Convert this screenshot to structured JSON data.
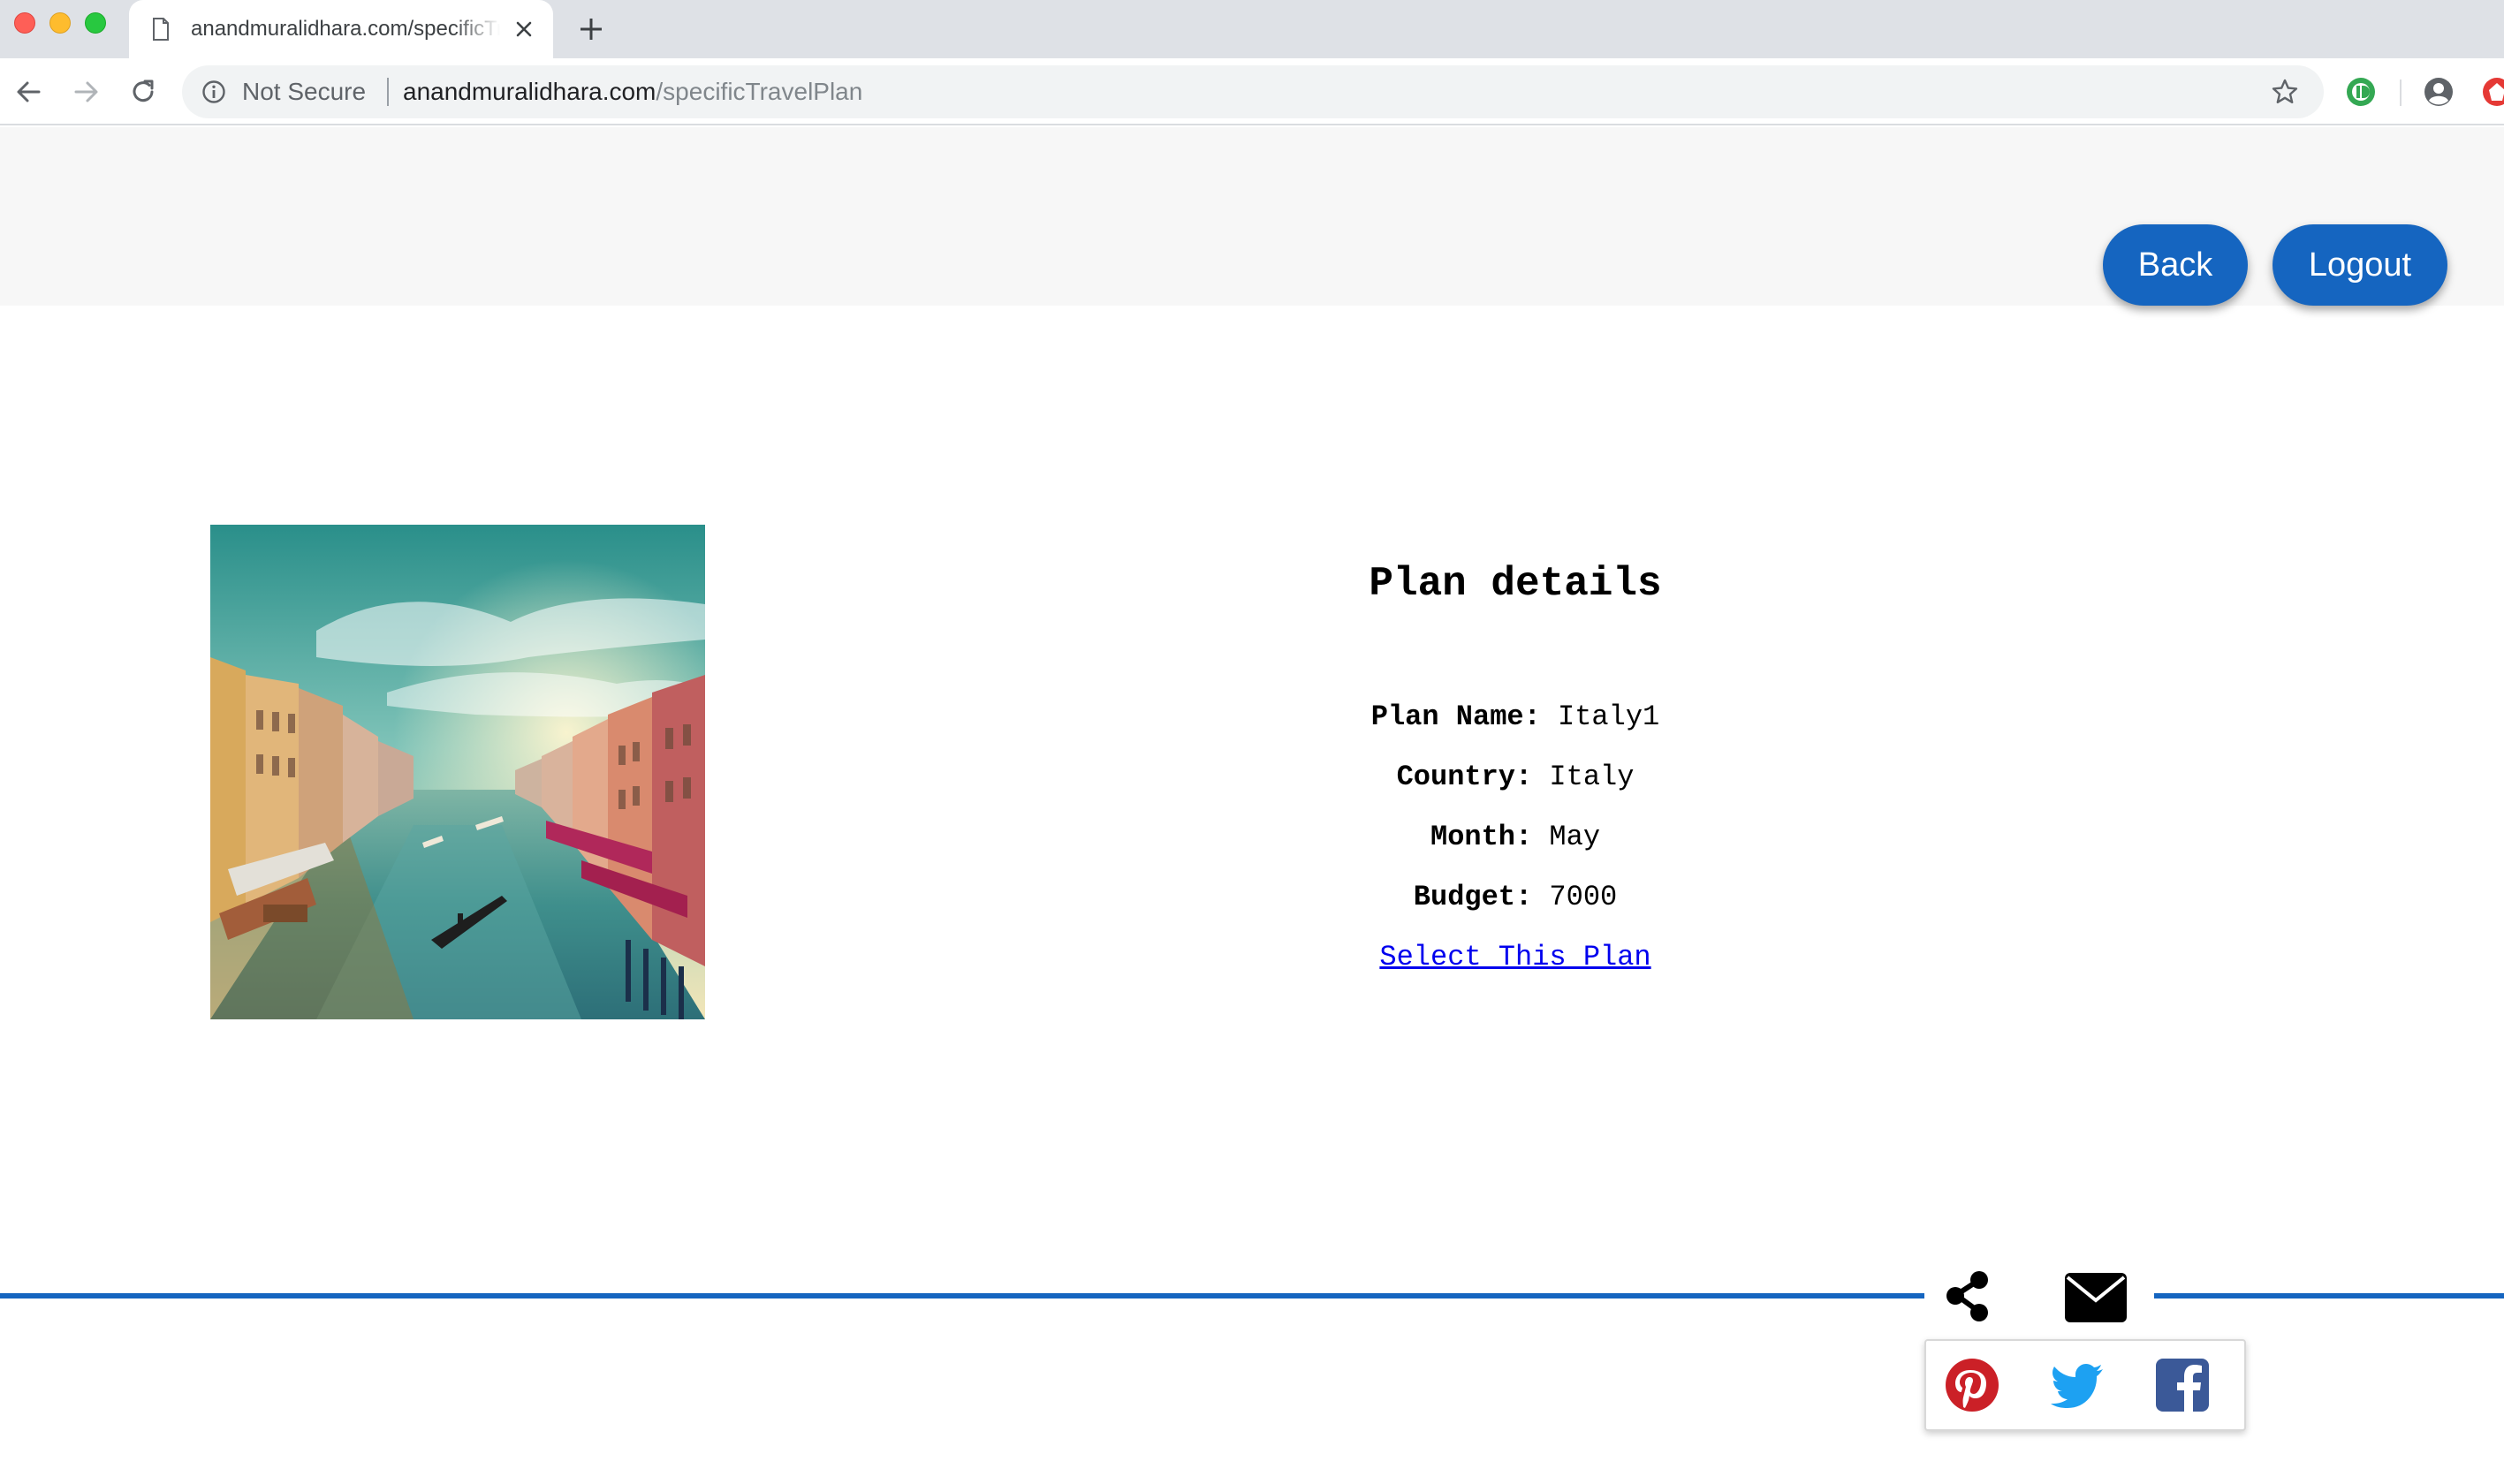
{
  "browser": {
    "tab_title": "anandmuralidhara.com/specificTravelPlan",
    "security_label": "Not Secure",
    "url_host": "anandmuralidhara.com",
    "url_path": "/specificTravelPlan"
  },
  "header": {
    "back_label": "Back",
    "logout_label": "Logout"
  },
  "plan": {
    "title": "Plan details",
    "fields": [
      {
        "label": "Plan Name:",
        "value": "Italy1"
      },
      {
        "label": "Country:",
        "value": "Italy"
      },
      {
        "label": "Month:",
        "value": "May"
      },
      {
        "label": "Budget:",
        "value": "7000"
      }
    ],
    "select_link": "Select This Plan"
  },
  "share": {
    "icons": [
      "share-icon",
      "envelope-icon",
      "pinterest-icon",
      "twitter-icon",
      "facebook-icon"
    ]
  },
  "colors": {
    "accent": "#1565c0",
    "pinterest": "#cb2027",
    "twitter": "#1da1f2",
    "facebook": "#3b5998"
  }
}
